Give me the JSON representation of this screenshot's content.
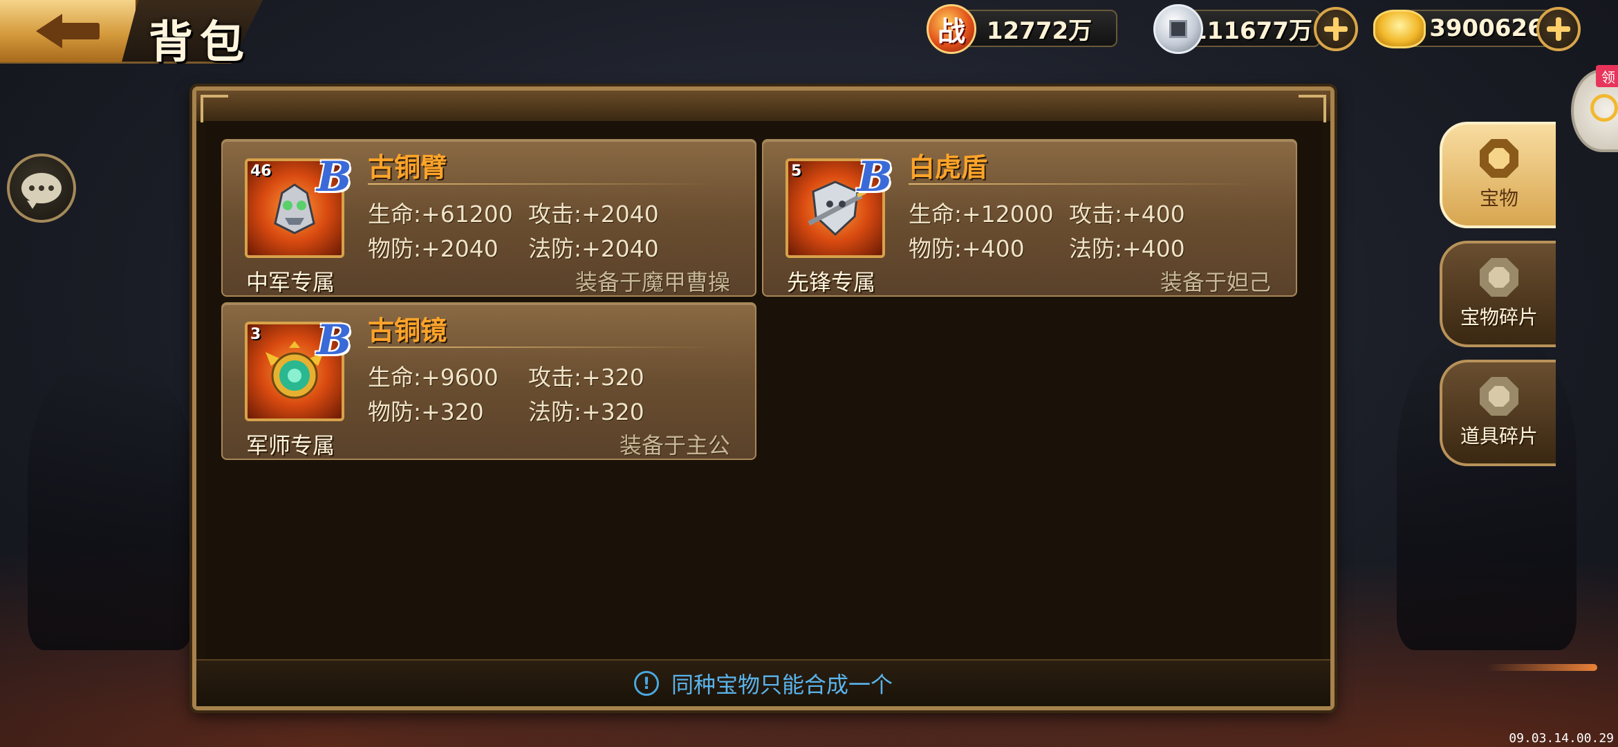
{
  "header": {
    "back_icon": "back-arrow-icon",
    "title": "背包"
  },
  "currencies": {
    "battle_power": {
      "icon_text": "战",
      "value": "12772万"
    },
    "silver": {
      "value": "111677万"
    },
    "gold": {
      "value": "3900626"
    }
  },
  "items": [
    {
      "name": "古铜臂",
      "level": "46",
      "rank": "B",
      "role": "中军专属",
      "stats": {
        "hp": "生命:+61200",
        "atk": "攻击:+2040",
        "pdef": "物防:+2040",
        "mdef": "法防:+2040"
      },
      "equipped": "装备于魔甲曹操"
    },
    {
      "name": "白虎盾",
      "level": "5",
      "rank": "B",
      "role": "先锋专属",
      "stats": {
        "hp": "生命:+12000",
        "atk": "攻击:+400",
        "pdef": "物防:+400",
        "mdef": "法防:+400"
      },
      "equipped": "装备于妲己"
    },
    {
      "name": "古铜镜",
      "level": "3",
      "rank": "B",
      "role": "军师专属",
      "stats": {
        "hp": "生命:+9600",
        "atk": "攻击:+320",
        "pdef": "物防:+320",
        "mdef": "法防:+320"
      },
      "equipped": "装备于主公"
    }
  ],
  "tabs": [
    {
      "label": "宝物",
      "active": true
    },
    {
      "label": "宝物碎片",
      "active": false
    },
    {
      "label": "道具碎片",
      "active": false
    }
  ],
  "claim": {
    "badge": "领"
  },
  "footer": {
    "notice": "同种宝物只能合成一个",
    "icon_text": "!"
  },
  "timestamp": "09.03.14.00.29",
  "colors": {
    "accent_gold": "#d8a24a",
    "item_name": "#ffa42a",
    "notice_blue": "#5ab4ec",
    "rank_blue": "#3a6ad8"
  }
}
